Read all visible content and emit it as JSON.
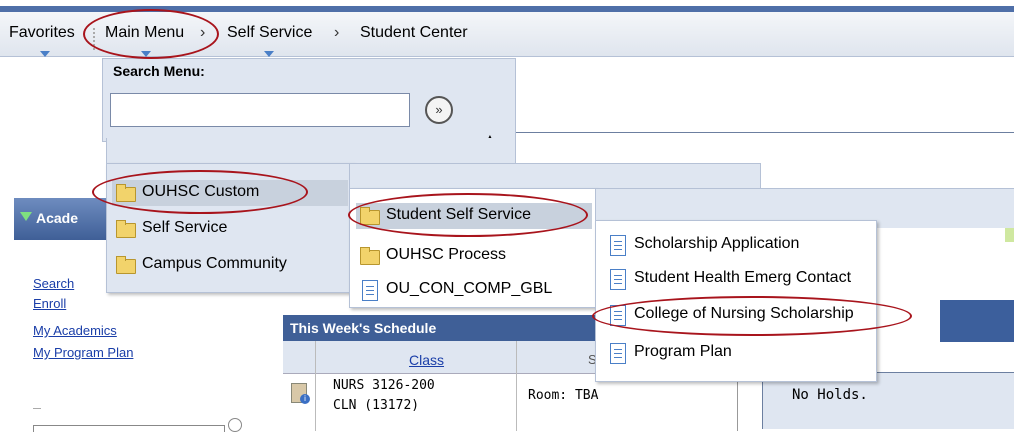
{
  "nav": {
    "favorites": "Favorites",
    "main_menu": "Main Menu",
    "separator": "›",
    "self_service": "Self Service",
    "student_center": "Student Center"
  },
  "search": {
    "label": "Search Menu:",
    "value": "",
    "go_icon": "»"
  },
  "menu_level1": [
    {
      "label": "OUHSC Custom",
      "icon": "folder-icon",
      "selected": true
    },
    {
      "label": "Self Service",
      "icon": "folder-icon"
    },
    {
      "label": "Campus Community",
      "icon": "folder-icon"
    }
  ],
  "menu_level2": [
    {
      "label": "Student Self Service",
      "icon": "folder-icon",
      "selected": true
    },
    {
      "label": "OUHSC Process",
      "icon": "folder-icon"
    },
    {
      "label": "OU_CON_COMP_GBL",
      "icon": "page-icon"
    }
  ],
  "menu_level3": [
    {
      "label": "Scholarship Application",
      "icon": "page-icon"
    },
    {
      "label": "Student Health Emerg Contact",
      "icon": "page-icon"
    },
    {
      "label": "College of Nursing Scholarship",
      "icon": "page-icon"
    },
    {
      "label": "Program Plan",
      "icon": "page-icon"
    }
  ],
  "academics": {
    "header": "Acade",
    "links": [
      "Search",
      "Enroll",
      "My Academics",
      "My Program Plan"
    ]
  },
  "schedule": {
    "header": "This Week's Schedule",
    "class_col": "Class",
    "course_line1": "NURS 3126-200",
    "course_line2": "CLN (13172)",
    "room": "Room:  TBA"
  },
  "holds": {
    "text": "No Holds."
  },
  "colors": {
    "accent_blue": "#3f5f97",
    "annotation_red": "#a8141c",
    "menu_bg": "#dfe6f1"
  }
}
